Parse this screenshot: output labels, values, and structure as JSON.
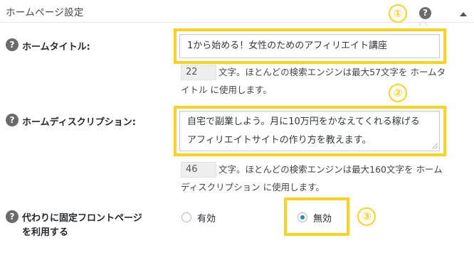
{
  "header": {
    "title": "ホームページ設定",
    "help_icon": "?"
  },
  "markers": [
    "①",
    "②",
    "③"
  ],
  "home_title": {
    "label": "ホームタイトル:",
    "value": "1から始める！女性のためのアフィリエイト講座",
    "char_count": "22",
    "desc_line1": "文字。ほとんどの検索エンジンは最大57文字を ホームタ",
    "desc_line2": "イトル に使用します。"
  },
  "home_description": {
    "label": "ホームディスクリプション:",
    "value_line1": "自宅で副業しよう。月に10万円をかなえてくれる稼げる",
    "value_line2": "アフィリエイトサイトの作り方を教えます。",
    "char_count": "46",
    "desc_line1": "文字。ほとんどの検索エンジンは最大160文字を ホーム",
    "desc_line2": "ディスクリプション に使用します。"
  },
  "static_front": {
    "label_line1": "代わりに固定フロントページ",
    "label_line2": "を利用する",
    "options": [
      {
        "label": "有効",
        "selected": false
      },
      {
        "label": "無効",
        "selected": true
      }
    ]
  },
  "colors": {
    "highlight": "#ffd21f",
    "radio_selected": "#1e8cbe",
    "help_icon_bg": "#6b6b6b"
  }
}
